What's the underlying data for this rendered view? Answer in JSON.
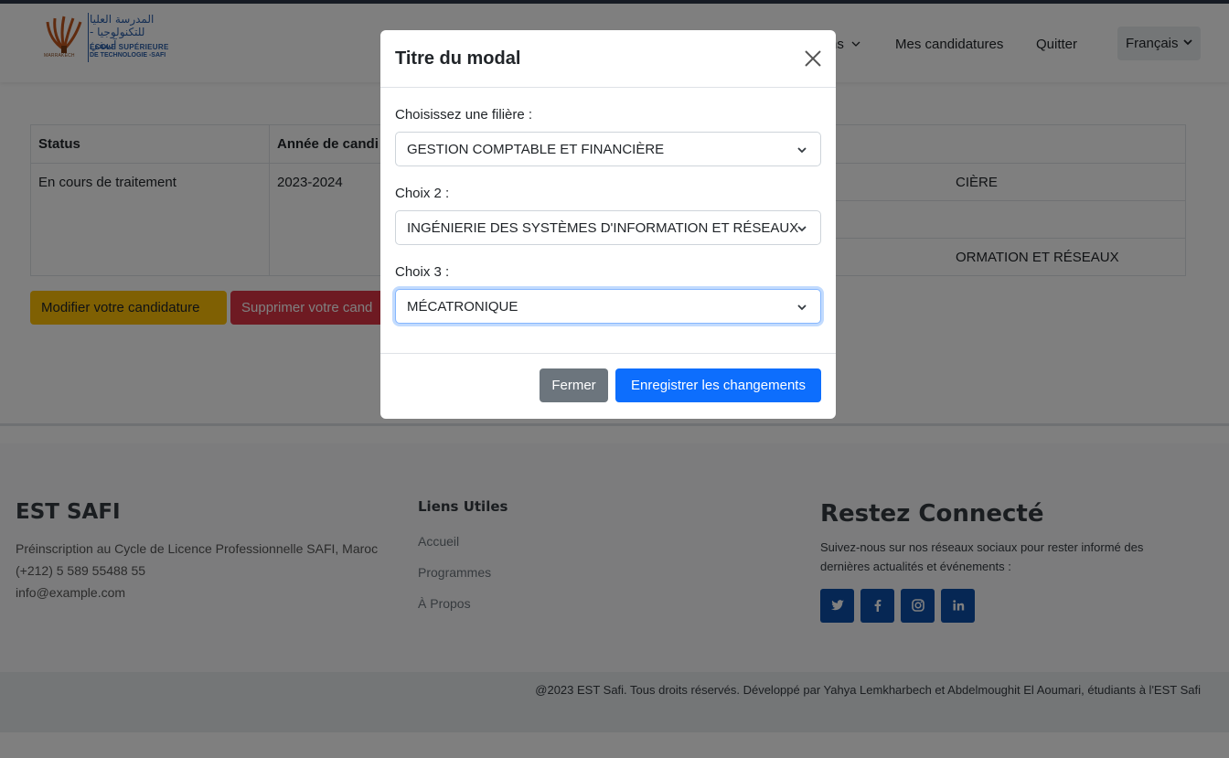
{
  "header": {
    "logo": {
      "school_name_small": "MARRAKECH",
      "arabic_line1": "المدرسة العليا",
      "arabic_line2": "للتكنولوجيا - آسفي",
      "french_line1": "ÉCOLE SUPÉRIEURE",
      "french_line2": "DE TECHNOLOGIE -SAFI"
    },
    "nav": {
      "dropdown_label": "ns",
      "candidatures_label": "Mes candidatures",
      "quit_label": "Quitter"
    },
    "language": {
      "selected": "Français"
    }
  },
  "candidatures_table": {
    "headers": [
      "Status",
      "Année de candi",
      "",
      ""
    ],
    "row": {
      "status": "En cours de traitement",
      "year": "2023-2024",
      "choice1_partial": "CIÈRE",
      "choice2_partial": "",
      "choice3_partial": "ORMATION ET RÉSEAUX"
    }
  },
  "actions": {
    "modify_label": "Modifier votre candidature",
    "delete_label": "Supprimer votre cand"
  },
  "footer": {
    "col1": {
      "title": "EST SAFI",
      "line1": "Préinscription au Cycle de Licence Professionnelle SAFI, Maroc",
      "phone": "(+212) 5 589 55488 55",
      "email": "info@example.com"
    },
    "col2": {
      "title": "Liens Utiles",
      "links": [
        "Accueil",
        "Programmes",
        "À Propos"
      ]
    },
    "col3": {
      "title": "Restez Connecté",
      "text": "Suivez-nous sur nos réseaux sociaux pour rester informé des dernières actualités et événements :",
      "socials": [
        "twitter-icon",
        "facebook-icon",
        "instagram-icon",
        "linkedin-icon"
      ]
    },
    "copyright": "@2023 EST Safi. Tous droits réservés. Développé par Yahya Lemkharbech et Abdelmoughit El Aoumari, étudiants à l'EST Safi"
  },
  "modal": {
    "title": "Titre du modal",
    "field1": {
      "label": "Choisissez une filière :",
      "value": "GESTION COMPTABLE ET FINANCIÈRE"
    },
    "field2": {
      "label": "Choix 2 :",
      "value": "INGÉNIERIE DES SYSTÈMES D'INFORMATION ET RÉSEAUX"
    },
    "field3": {
      "label": "Choix 3 :",
      "value": "MÉCATRONIQUE"
    },
    "close_label": "Fermer",
    "save_label": "Enregistrer les changements"
  },
  "colors": {
    "primary": "#0d6efd",
    "secondary": "#6c757d",
    "warning": "#ffc107",
    "danger": "#dc3545",
    "social": "#0d4fa8"
  }
}
